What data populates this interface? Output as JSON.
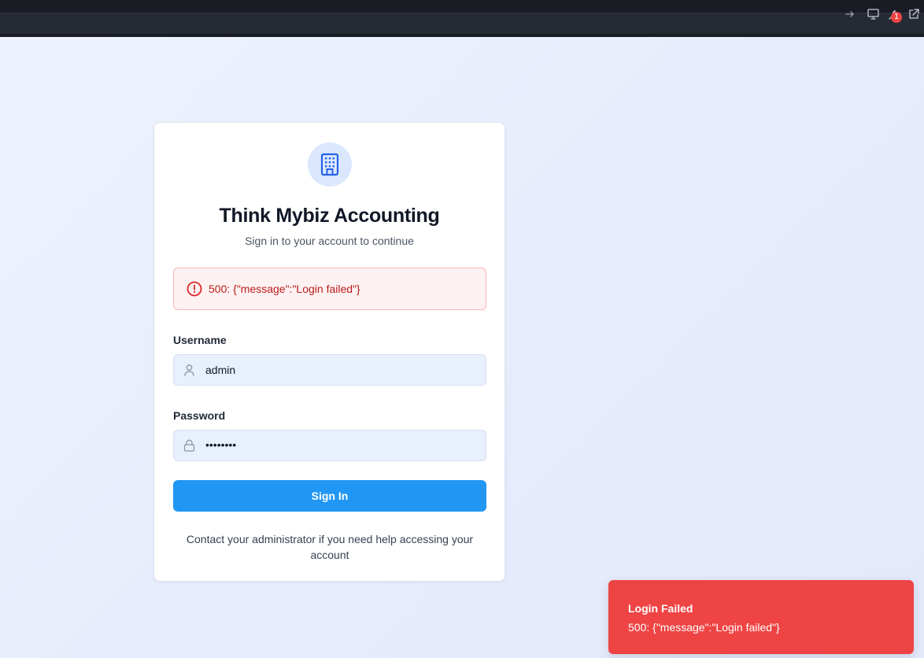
{
  "toolbar": {
    "icons": [
      "arrow-right-icon",
      "monitor-icon",
      "wrench-icon",
      "external-link-icon"
    ],
    "badge_count": "1"
  },
  "login": {
    "app_title": "Think Mybiz Accounting",
    "subtitle": "Sign in to your account to continue",
    "error_message": "500: {\"message\":\"Login failed\"}",
    "username_label": "Username",
    "username_value": "admin",
    "password_label": "Password",
    "password_masked": "••••••••",
    "signin_label": "Sign In",
    "help_text": "Contact your administrator if you need help accessing your account"
  },
  "toast": {
    "title": "Login Failed",
    "message": "500: {\"message\":\"Login failed\"}"
  },
  "colors": {
    "primary": "#2196f3",
    "error": "#ef4444",
    "error_text": "#b91c1c",
    "input_bg": "#e8effd"
  }
}
